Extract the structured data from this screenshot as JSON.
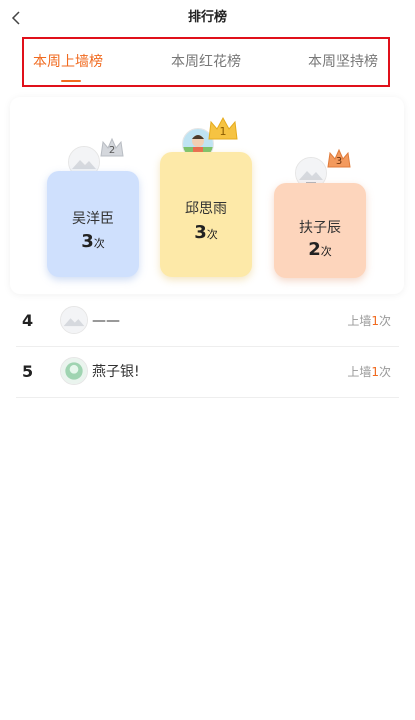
{
  "header": {
    "title": "排行榜"
  },
  "tabs": [
    {
      "label": "本周上墙榜",
      "active": true
    },
    {
      "label": "本周红花榜",
      "active": false
    },
    {
      "label": "本周坚持榜",
      "active": false
    }
  ],
  "podium": [
    {
      "rank": "1",
      "name": "邱思雨",
      "count": "3",
      "unit": "次"
    },
    {
      "rank": "2",
      "name": "吴洋臣",
      "count": "3",
      "unit": "次"
    },
    {
      "rank": "3",
      "name": "扶子辰",
      "count": "2",
      "unit": "次"
    }
  ],
  "list": [
    {
      "rank": "4",
      "name": "——",
      "prefix": "上墙",
      "count": "1",
      "unit": "次"
    },
    {
      "rank": "5",
      "name": "燕子银!",
      "prefix": "上墙",
      "count": "1",
      "unit": "次"
    }
  ],
  "colors": {
    "accent": "#f06a1f",
    "highlight_border": "#e0101a",
    "gold": "#f6c342",
    "silver": "#cfd2d8",
    "bronze": "#f39a5e"
  },
  "icons": {
    "back": "chevron-left-icon",
    "crown": "crown-icon"
  }
}
